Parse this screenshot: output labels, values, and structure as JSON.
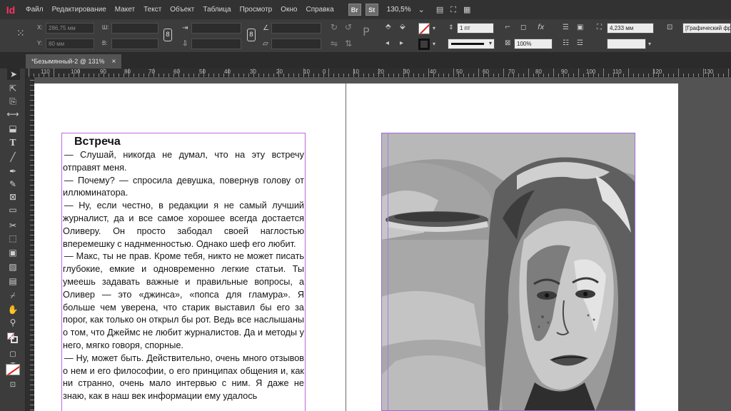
{
  "app": {
    "logo": "Id"
  },
  "menu": {
    "items": [
      "Файл",
      "Редактирование",
      "Макет",
      "Текст",
      "Объект",
      "Таблица",
      "Просмотр",
      "Окно",
      "Справка"
    ],
    "badges": [
      "Br",
      "St"
    ],
    "zoom": "130,5%"
  },
  "control": {
    "x_label": "X:",
    "x_value": "286,75 мм",
    "y_label": "Y:",
    "y_value": "80 мм",
    "w_label": "Ш:",
    "h_label": "В:",
    "stroke_weight": "1 пт",
    "opacity": "100%",
    "dimension": "4,233 мм",
    "object_style": "[Графический фр"
  },
  "tab": {
    "title": "*Безымянный-2 @ 131%",
    "close": "×"
  },
  "ruler": {
    "labels": [
      "110",
      "100",
      "90",
      "80",
      "70",
      "60",
      "50",
      "40",
      "30",
      "20",
      "10",
      "0",
      "10",
      "20",
      "30",
      "40",
      "50",
      "60",
      "70",
      "80",
      "90",
      "100",
      "110",
      "120",
      "130"
    ]
  },
  "story": {
    "title": "Встреча",
    "paragraphs": [
      "— Слушай, никогда не думал, что на эту встречу отправят меня.",
      "— Почему? — спросила девушка, повернув голову от иллюминатора.",
      "— Ну, если честно, в редакции я не самый лучший журналист, да и все самое хорошее всегда достается Оливеру. Он просто забодал своей наглостью вперемешку с наднменностью. Однако шеф его любит.",
      "— Макс, ты не прав. Кроме тебя, никто не может писать глубокие, емкие и одновременно легкие статьи. Ты умеешь задавать важные и правильные вопросы, а Оливер — это «джинса», «попса для гламура». Я больше чем уверена, что старик выставил бы его за порог, как только он открыл бы рот. Ведь все наслышаны о том, что Джеймс не любит журналистов. Да и методы у него, мягко говоря, спорные.",
      "— Ну, может быть. Действительно, очень много отзывов о нем и его философии, о его принципах общения и, как ни странно, очень мало интервью с ним. Я даже не знаю, как в наш век информации ему удалось"
    ]
  },
  "colors": {
    "frame_text": "#c266e0",
    "frame_image": "#a06ad8",
    "logo": "#ff3366"
  }
}
